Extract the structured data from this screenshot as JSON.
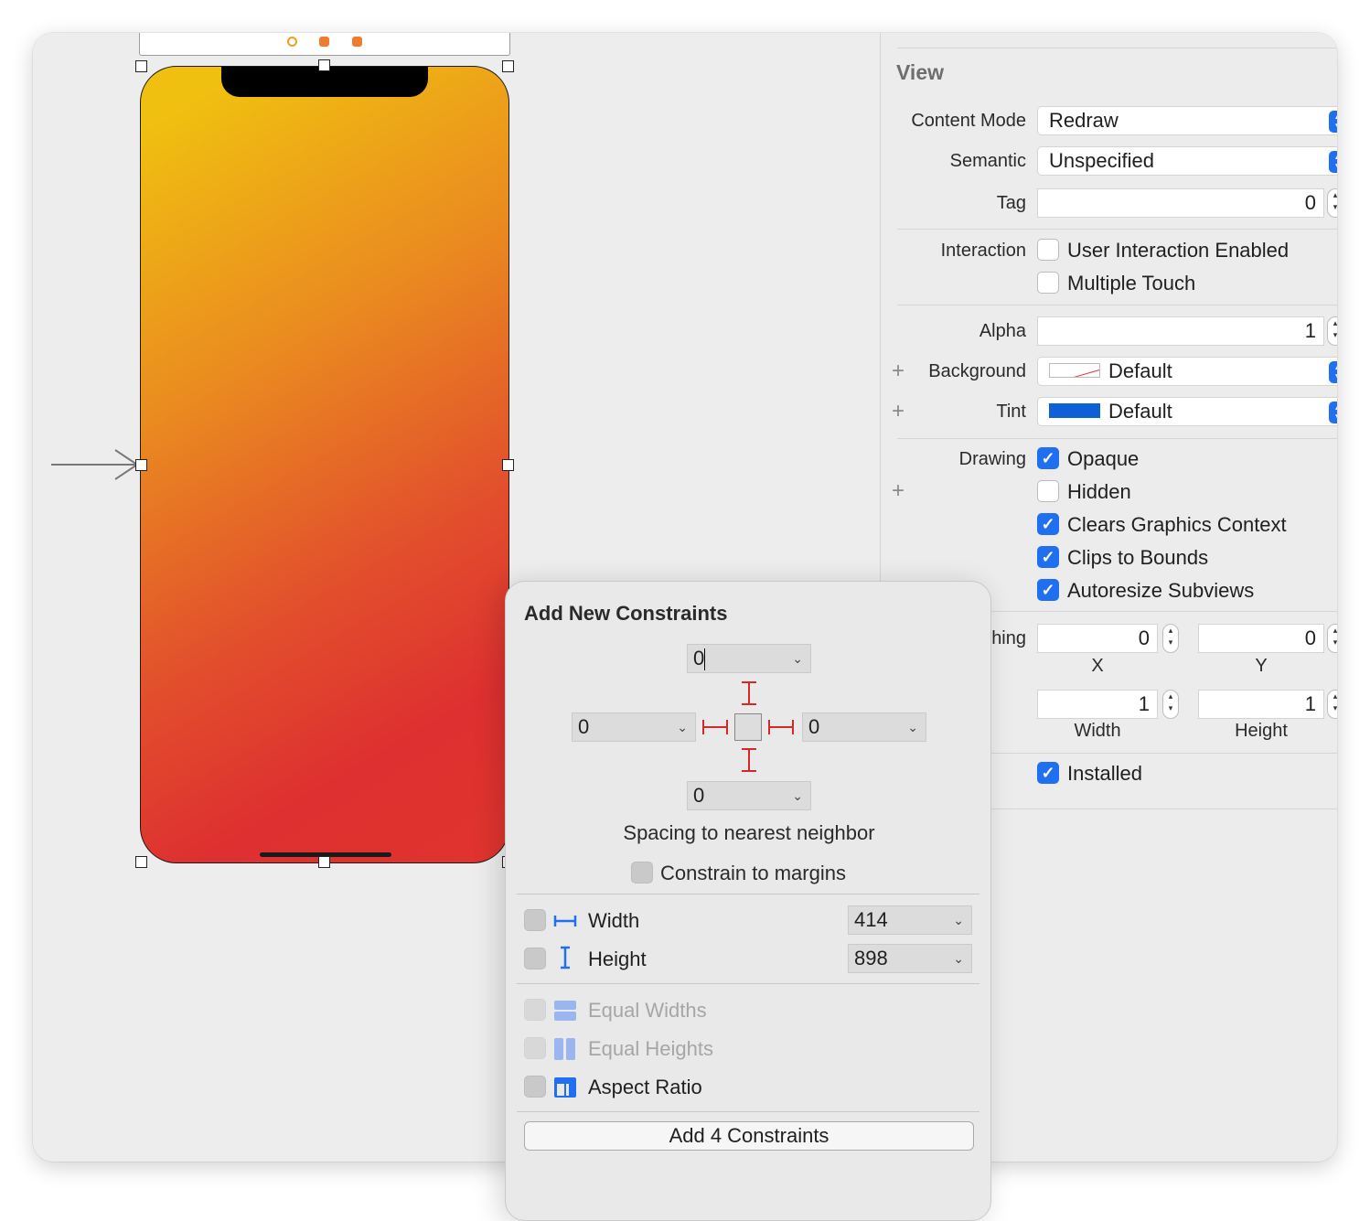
{
  "inspector": {
    "section_title": "View",
    "content_mode": {
      "label": "Content Mode",
      "value": "Redraw"
    },
    "semantic": {
      "label": "Semantic",
      "value": "Unspecified"
    },
    "tag": {
      "label": "Tag",
      "value": "0"
    },
    "interaction": {
      "label": "Interaction",
      "options": [
        {
          "label": "User Interaction Enabled",
          "checked": false
        },
        {
          "label": "Multiple Touch",
          "checked": false
        }
      ]
    },
    "alpha": {
      "label": "Alpha",
      "value": "1"
    },
    "background": {
      "label": "Background",
      "value": "Default"
    },
    "tint": {
      "label": "Tint",
      "value": "Default",
      "color": "#0f5fd6"
    },
    "drawing": {
      "label": "Drawing",
      "options": [
        {
          "label": "Opaque",
          "checked": true
        },
        {
          "label": "Hidden",
          "checked": false
        },
        {
          "label": "Clears Graphics Context",
          "checked": true
        },
        {
          "label": "Clips to Bounds",
          "checked": true
        },
        {
          "label": "Autoresize Subviews",
          "checked": true
        }
      ]
    },
    "stretching": {
      "label_visible": "hing",
      "x": "0",
      "y": "0",
      "width": "1",
      "height": "1",
      "x_label": "X",
      "y_label": "Y",
      "width_label": "Width",
      "height_label": "Height"
    },
    "installed": {
      "label": "Installed",
      "checked": true
    }
  },
  "constraints_popover": {
    "title": "Add New Constraints",
    "top": "0",
    "left": "0",
    "right": "0",
    "bottom": "0",
    "spacing_caption": "Spacing to nearest neighbor",
    "constrain_to_margins": "Constrain to margins",
    "width": {
      "label": "Width",
      "value": "414"
    },
    "height": {
      "label": "Height",
      "value": "898"
    },
    "equal_widths": "Equal Widths",
    "equal_heights": "Equal Heights",
    "aspect_ratio": "Aspect Ratio",
    "add_button": "Add 4 Constraints"
  },
  "colors": {
    "accent": "#1f6ff0",
    "constraint_red": "#d62828",
    "gradient_top": "#f0c010",
    "gradient_bottom": "#e0342e"
  }
}
